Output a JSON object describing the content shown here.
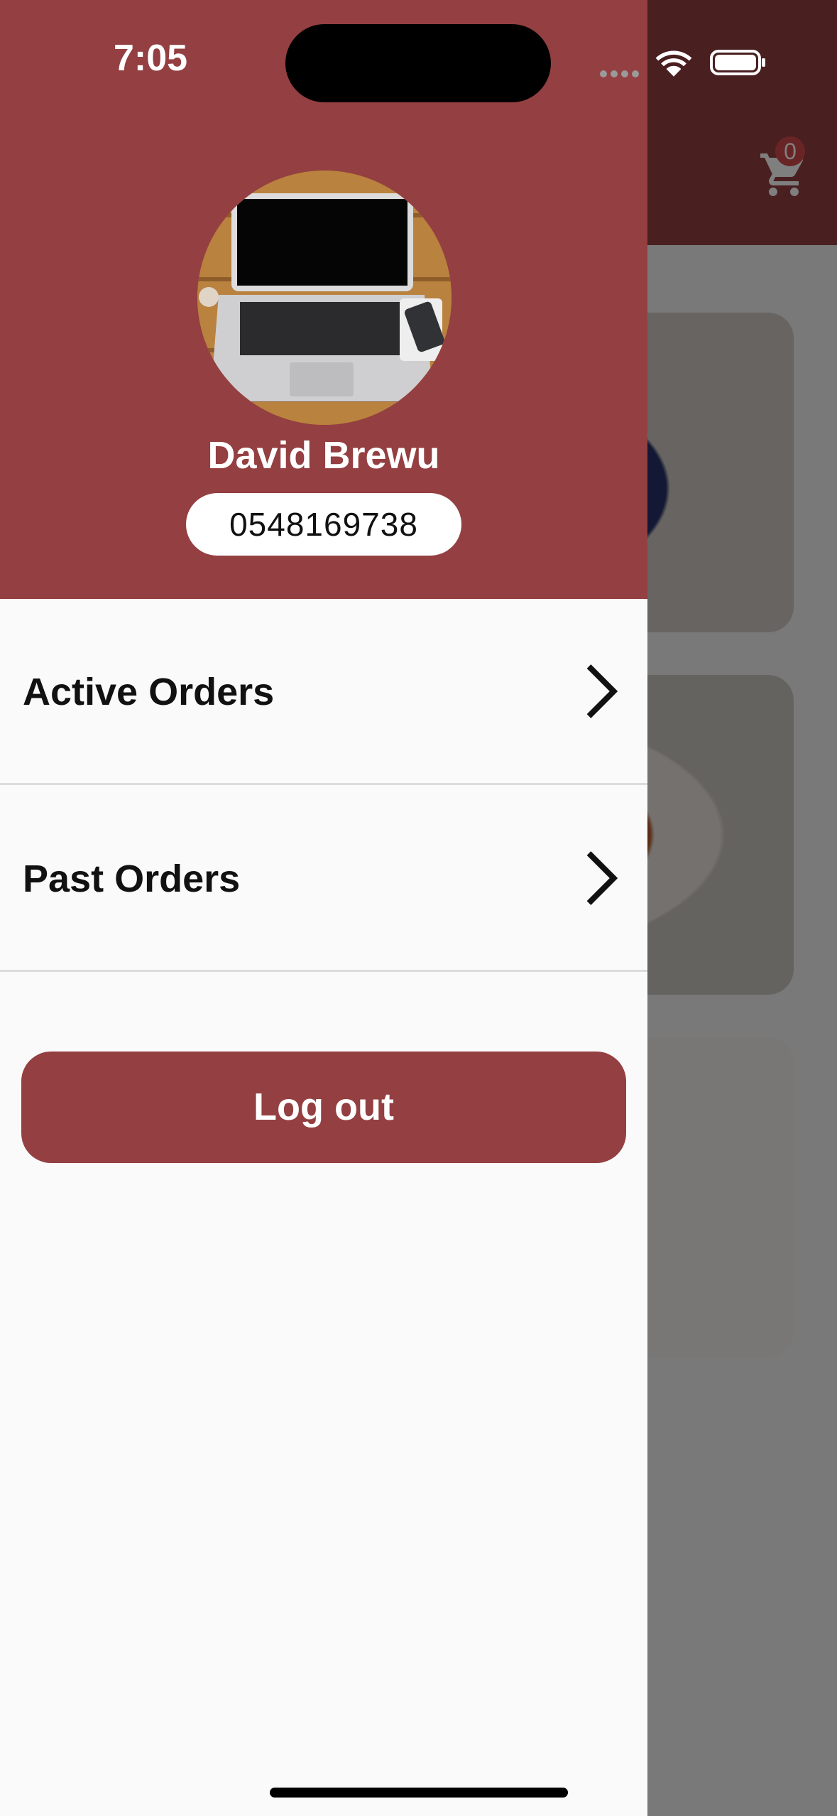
{
  "status_bar": {
    "time": "7:05",
    "icons": [
      "wifi-icon",
      "battery-icon"
    ]
  },
  "background": {
    "cart_badge_count": "0",
    "cart_icon": "shopping-cart-icon"
  },
  "drawer": {
    "profile": {
      "avatar_icon": "laptop-photo",
      "name": "David Brewu",
      "phone": "0548169738"
    },
    "menu_items": [
      {
        "label": "Active Orders",
        "icon": "chevron-right-icon"
      },
      {
        "label": "Past Orders",
        "icon": "chevron-right-icon"
      }
    ],
    "logout_label": "Log out"
  },
  "colors": {
    "brand": "#943f41",
    "drawer_bg": "#fafafa",
    "divider": "#dcdcdc"
  }
}
